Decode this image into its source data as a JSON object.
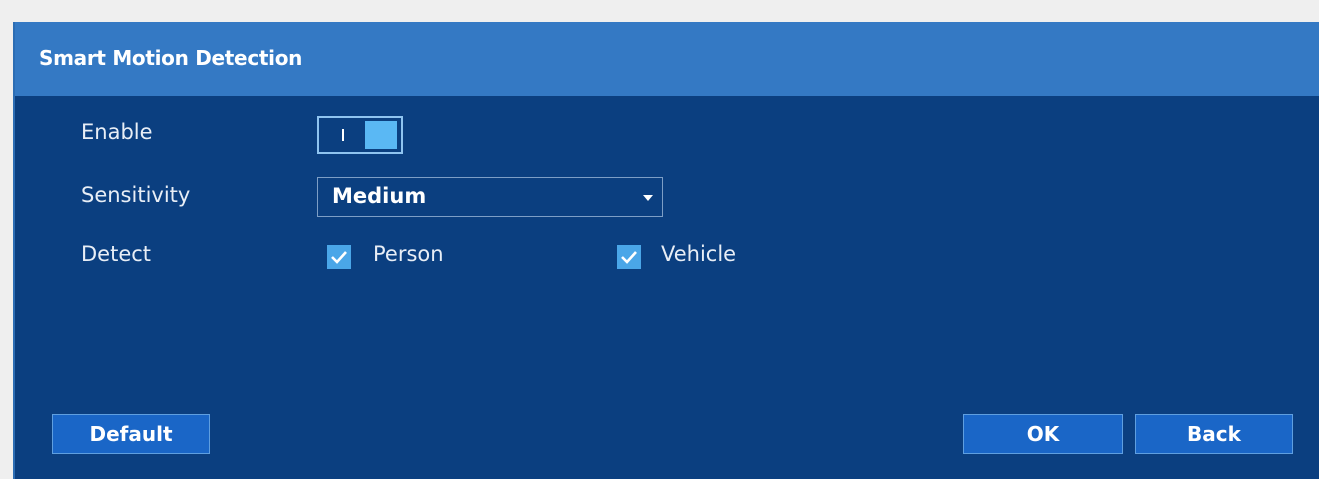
{
  "dialog": {
    "title": "Smart Motion Detection"
  },
  "enable": {
    "label": "Enable",
    "on": true
  },
  "sensitivity": {
    "label": "Sensitivity",
    "value": "Medium"
  },
  "detect": {
    "label": "Detect",
    "options": [
      {
        "label": "Person",
        "checked": true
      },
      {
        "label": "Vehicle",
        "checked": true
      }
    ]
  },
  "buttons": {
    "default_label": "Default",
    "ok_label": "OK",
    "back_label": "Back"
  },
  "colors": {
    "panel_bg": "#0b3f80",
    "titlebar_bg": "#3479c4",
    "accent": "#4aa6e8",
    "button_bg": "#1a66c7"
  }
}
